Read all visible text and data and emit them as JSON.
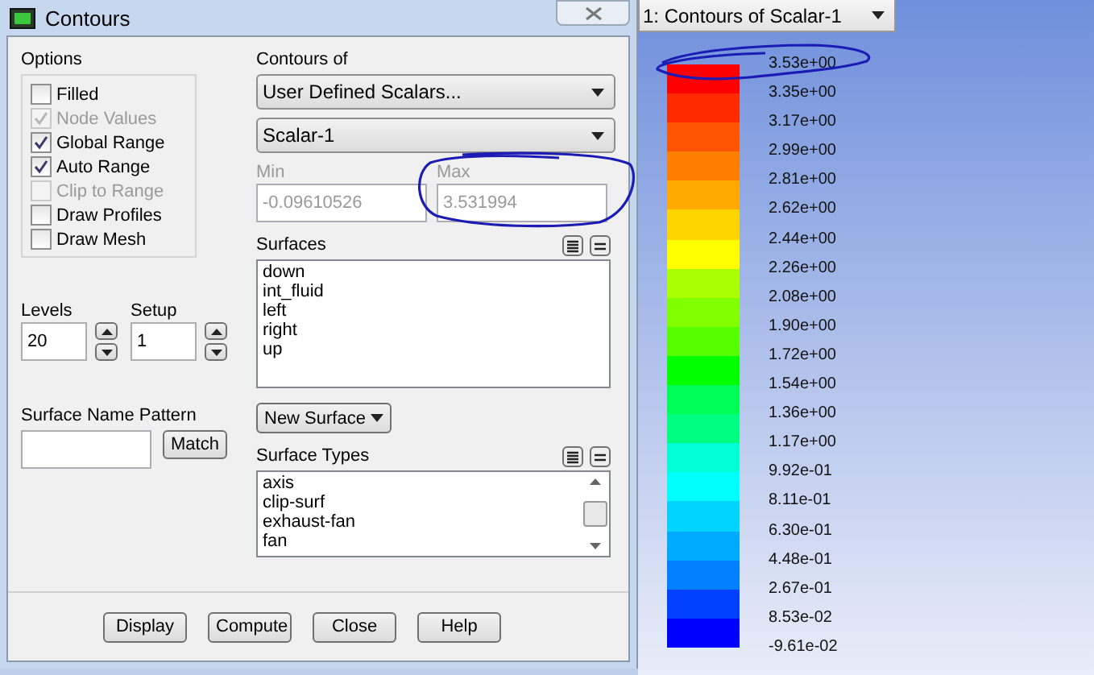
{
  "dialog": {
    "title": "Contours",
    "options": {
      "label": "Options",
      "items": [
        {
          "label": "Filled",
          "checked": false,
          "disabled": false
        },
        {
          "label": "Node Values",
          "checked": true,
          "disabled": true
        },
        {
          "label": "Global Range",
          "checked": true,
          "disabled": false
        },
        {
          "label": "Auto Range",
          "checked": true,
          "disabled": false
        },
        {
          "label": "Clip to Range",
          "checked": false,
          "disabled": true
        },
        {
          "label": "Draw Profiles",
          "checked": false,
          "disabled": false
        },
        {
          "label": "Draw Mesh",
          "checked": false,
          "disabled": false
        }
      ]
    },
    "contours_of": {
      "label": "Contours of",
      "category": "User Defined Scalars...",
      "variable": "Scalar-1"
    },
    "min": {
      "label": "Min",
      "value": "-0.09610526",
      "disabled": true
    },
    "max": {
      "label": "Max",
      "value": "3.531994",
      "disabled": true
    },
    "levels": {
      "label": "Levels",
      "value": "20"
    },
    "setup": {
      "label": "Setup",
      "value": "1"
    },
    "surfaces": {
      "label": "Surfaces",
      "items": [
        {
          "label": "down",
          "selected": false
        },
        {
          "label": "int_fluid",
          "selected": false
        },
        {
          "label": "left",
          "selected": false
        },
        {
          "label": "right",
          "selected": false
        },
        {
          "label": "up",
          "selected": false
        }
      ]
    },
    "surface_name_pattern": {
      "label": "Surface Name Pattern",
      "match_button": "Match"
    },
    "new_surface_button": "New Surface",
    "surface_types": {
      "label": "Surface Types",
      "items": [
        {
          "label": "axis",
          "selected": false
        },
        {
          "label": "clip-surf",
          "selected": false
        },
        {
          "label": "exhaust-fan",
          "selected": false
        },
        {
          "label": "fan",
          "selected": false
        }
      ]
    },
    "buttons": [
      "Display",
      "Compute",
      "Close",
      "Help"
    ]
  },
  "graphics_window": {
    "selector": "1: Contours of Scalar-1",
    "legend": {
      "labels": [
        "3.53e+00",
        "3.35e+00",
        "3.17e+00",
        "2.99e+00",
        "2.81e+00",
        "2.62e+00",
        "2.44e+00",
        "2.26e+00",
        "2.08e+00",
        "1.90e+00",
        "1.72e+00",
        "1.54e+00",
        "1.36e+00",
        "1.17e+00",
        "9.92e-01",
        "8.11e-01",
        "6.30e-01",
        "4.48e-01",
        "2.67e-01",
        "8.53e-02",
        "-9.61e-02"
      ],
      "bands": [
        {
          "color": "#ff0000"
        },
        {
          "color": "#ff2a00"
        },
        {
          "color": "#ff5500"
        },
        {
          "color": "#ff8000"
        },
        {
          "color": "#ffaa00"
        },
        {
          "color": "#ffd400"
        },
        {
          "color": "#ffff00"
        },
        {
          "color": "#aaff00"
        },
        {
          "color": "#80ff00"
        },
        {
          "color": "#55ff00"
        },
        {
          "color": "#00ff00"
        },
        {
          "color": "#00ff55"
        },
        {
          "color": "#00ff80"
        },
        {
          "color": "#00ffd4"
        },
        {
          "color": "#00ffff"
        },
        {
          "color": "#00d4ff"
        },
        {
          "color": "#00aaff"
        },
        {
          "color": "#0080ff"
        },
        {
          "color": "#0040ff"
        },
        {
          "color": "#0000ff"
        }
      ]
    }
  }
}
